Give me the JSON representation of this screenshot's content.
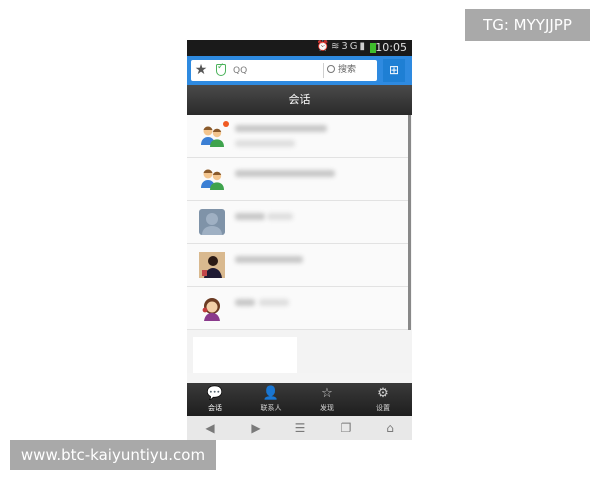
{
  "watermarks": {
    "top_right": "TG: MYYJJPP",
    "bottom_left": "www.btc-kaiyuntiyu.com"
  },
  "status_bar": {
    "time": "10:05",
    "network": "3G",
    "icons": [
      "alarm-icon",
      "wifi-icon",
      "signal-icon",
      "battery-icon"
    ]
  },
  "search": {
    "value": "QQ",
    "button_label": "搜索",
    "star_icon": "star-icon",
    "shield_icon": "shield-check-icon",
    "apps_icon": "apps-icon"
  },
  "title": "会话",
  "conversations": [
    {
      "avatar": "group-avatar-icon",
      "unread": true
    },
    {
      "avatar": "group-avatar-icon",
      "unread": false
    },
    {
      "avatar": "user-avatar-gray",
      "unread": false
    },
    {
      "avatar": "user-avatar-photo",
      "unread": false
    },
    {
      "avatar": "user-avatar-cartoon",
      "unread": false
    }
  ],
  "tabs": [
    {
      "label": "会话",
      "icon": "chat-bubble-icon",
      "active": true
    },
    {
      "label": "联系人",
      "icon": "person-icon",
      "active": false
    },
    {
      "label": "发现",
      "icon": "star-icon",
      "active": false
    },
    {
      "label": "设置",
      "icon": "gear-icon",
      "active": false
    }
  ],
  "nav_buttons": [
    "back-icon",
    "forward-icon",
    "menu-icon",
    "windows-icon",
    "home-icon"
  ],
  "colors": {
    "accent": "#2e8ae0",
    "title_bar": "#333333",
    "unread_dot": "#f05a22",
    "battery": "#3fbe2d"
  }
}
